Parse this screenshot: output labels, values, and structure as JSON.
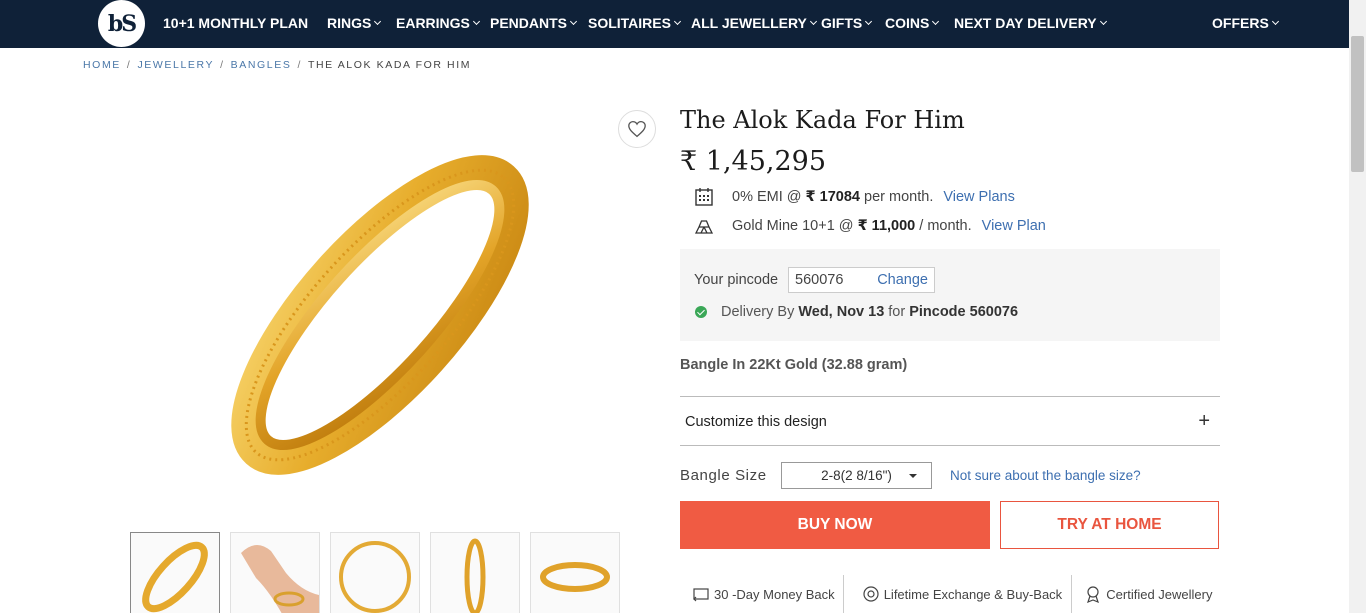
{
  "nav": {
    "logo_text": "bS",
    "items": [
      {
        "label": "10+1 MONTHLY PLAN",
        "has_dropdown": false
      },
      {
        "label": "RINGS",
        "has_dropdown": true
      },
      {
        "label": "EARRINGS",
        "has_dropdown": true
      },
      {
        "label": "PENDANTS",
        "has_dropdown": true
      },
      {
        "label": "SOLITAIRES",
        "has_dropdown": true
      },
      {
        "label": "ALL JEWELLERY",
        "has_dropdown": true
      },
      {
        "label": "GIFTS",
        "has_dropdown": true
      },
      {
        "label": "COINS",
        "has_dropdown": true
      },
      {
        "label": "NEXT DAY DELIVERY",
        "has_dropdown": true
      },
      {
        "label": "OFFERS",
        "has_dropdown": true
      }
    ]
  },
  "breadcrumb": {
    "items": [
      "HOME",
      "JEWELLERY",
      "BANGLES"
    ],
    "current": "THE ALOK KADA FOR HIM",
    "separator": "/"
  },
  "product": {
    "title": "The Alok Kada For Him",
    "price": "₹ 1,45,295",
    "emi": {
      "prefix": "0% EMI @",
      "amount": "₹ 17084",
      "suffix": "per month.",
      "link": "View Plans"
    },
    "goldmine": {
      "prefix": "Gold Mine 10+1 @",
      "amount": "₹ 11,000",
      "suffix": "/ month.",
      "link": "View Plan"
    },
    "material": "Bangle In 22Kt Gold (32.88 gram)"
  },
  "pincode": {
    "label": "Your pincode",
    "value": "560076",
    "change": "Change",
    "delivery_prefix": "Delivery By",
    "delivery_date": "Wed, Nov 13",
    "delivery_mid": "for",
    "delivery_pincode": "Pincode 560076"
  },
  "customize": {
    "label": "Customize this design",
    "icon": "+"
  },
  "size": {
    "label": "Bangle Size",
    "selected": "2-8(2 8/16\")",
    "help_link": "Not sure about the bangle size?"
  },
  "actions": {
    "buy": "BUY NOW",
    "try": "TRY AT HOME"
  },
  "assurances": [
    {
      "icon": "money-back-icon",
      "label": "30 -Day Money Back"
    },
    {
      "icon": "exchange-icon",
      "label": "Lifetime Exchange & Buy-Back"
    },
    {
      "icon": "certified-icon",
      "label": "Certified Jewellery"
    }
  ],
  "colors": {
    "nav_bg": "#0f2138",
    "accent": "#f05b43",
    "link": "#3d6fb0",
    "gold": "#e8b53a"
  }
}
